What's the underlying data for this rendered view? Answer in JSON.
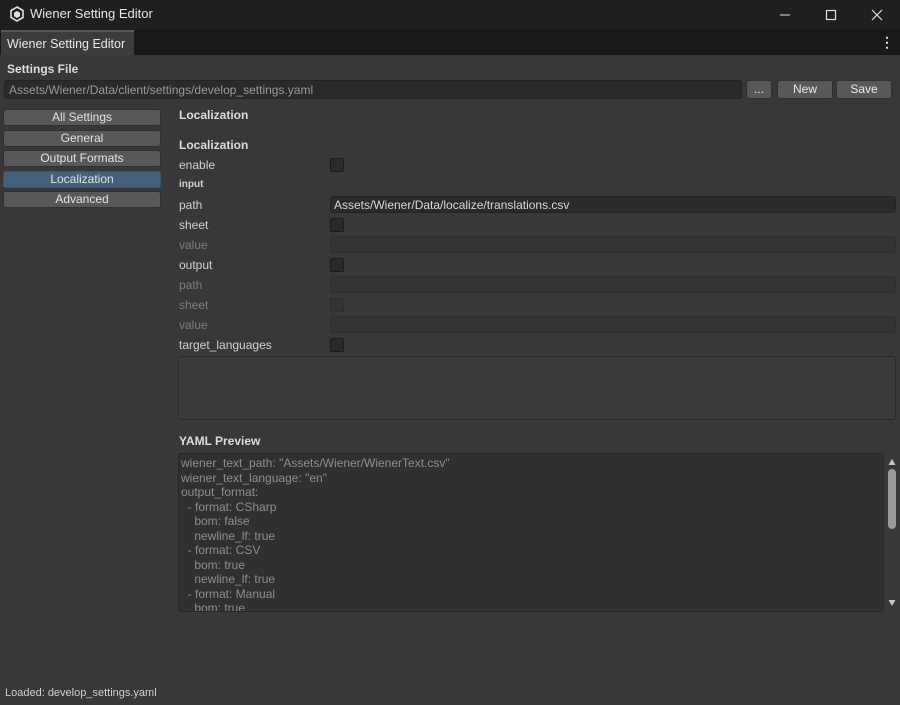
{
  "window": {
    "title": "Wiener Setting Editor",
    "minimize_icon": "minimize-icon",
    "maximize_icon": "maximize-icon",
    "close_icon": "close-icon"
  },
  "tab": {
    "label": "Wiener Setting Editor"
  },
  "settings_file": {
    "label": "Settings File",
    "path": "Assets/Wiener/Data/client/settings/develop_settings.yaml",
    "browse_label": "...",
    "new_label": "New",
    "save_label": "Save"
  },
  "sidebar": {
    "items": [
      {
        "label": "All Settings",
        "active": false
      },
      {
        "label": "General",
        "active": false
      },
      {
        "label": "Output Formats",
        "active": false
      },
      {
        "label": "Localization",
        "active": true
      },
      {
        "label": "Advanced",
        "active": false
      }
    ]
  },
  "content": {
    "section_title": "Localization",
    "group_title": "Localization",
    "enable_label": "enable",
    "input_label": "input",
    "input_path_label": "path",
    "input_path_value": "Assets/Wiener/Data/localize/translations.csv",
    "input_sheet_label": "sheet",
    "input_value_label": "value",
    "output_label": "output",
    "output_path_label": "path",
    "output_sheet_label": "sheet",
    "output_value_label": "value",
    "target_languages_label": "target_languages"
  },
  "yaml_preview": {
    "title": "YAML Preview",
    "text": "wiener_text_path: \"Assets/Wiener/WienerText.csv\"\nwiener_text_language: \"en\"\noutput_format:\n  - format: CSharp\n    bom: false\n    newline_lf: true\n  - format: CSV\n    bom: true\n    newline_lf: true\n  - format: Manual\n    bom: true"
  },
  "status": {
    "text": "Loaded: develop_settings.yaml"
  },
  "colors": {
    "background": "#383838",
    "titlebar": "#1f1f1f",
    "active_item": "#46607c",
    "button": "#585858"
  }
}
